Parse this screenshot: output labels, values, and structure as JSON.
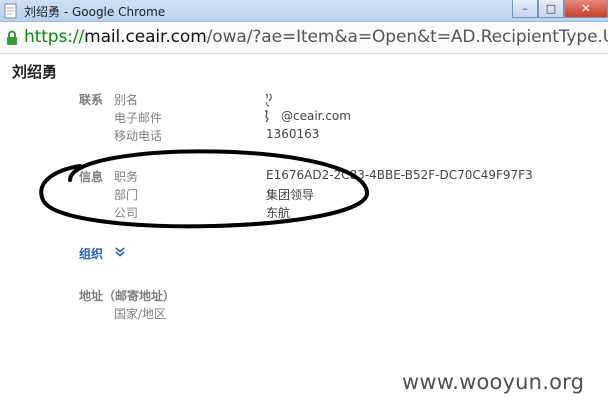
{
  "window": {
    "title": "刘绍勇 - Google Chrome",
    "minimize_label": "–",
    "maximize_label": "□",
    "close_label": "✕",
    "app_icon": "page-icon"
  },
  "address_bar": {
    "lock_icon": "lock-icon",
    "scheme": "https://",
    "host": "mail.ceair.com",
    "path": "/owa/?ae=Item&a=Open&t=AD.RecipientType.User&i"
  },
  "contact": {
    "name": "刘绍勇",
    "sections": {
      "contact": {
        "label": "联系",
        "fields": [
          {
            "label": "别名",
            "value": ""
          },
          {
            "label": "电子邮件",
            "value": "@ceair.com"
          },
          {
            "label": "移动电话",
            "value": "1360163"
          }
        ]
      },
      "info": {
        "label": "信息",
        "fields": [
          {
            "label": "职务",
            "value": "E1676AD2-2C83-4BBE-B52F-DC70C49F97F3"
          },
          {
            "label": "部门",
            "value": "集团领导"
          },
          {
            "label": "公司",
            "value": "东航"
          }
        ]
      },
      "org": {
        "label": "组织",
        "icon": "chevron-down-icon"
      },
      "address": {
        "label": "地址（邮寄地址）",
        "fields": [
          {
            "label": "国家/地区",
            "value": ""
          }
        ]
      }
    }
  },
  "annotation": {
    "color": "#000000"
  },
  "watermark": "www.wooyun.org"
}
